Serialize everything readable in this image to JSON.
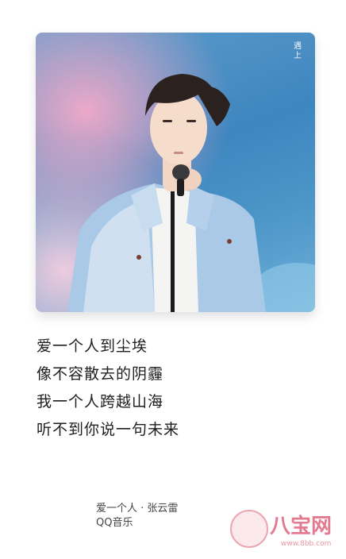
{
  "cover": {
    "mark": "遇 上"
  },
  "lyrics": [
    "爱一个人到尘埃",
    "像不容散去的阴霾",
    "我一个人跨越山海",
    "听不到你说一句未来"
  ],
  "song": {
    "title_artist": "爱一个人 · 张云雷",
    "app": "QQ音乐"
  },
  "watermark": {
    "brand": "八宝网",
    "url": "www.8bb.com"
  }
}
